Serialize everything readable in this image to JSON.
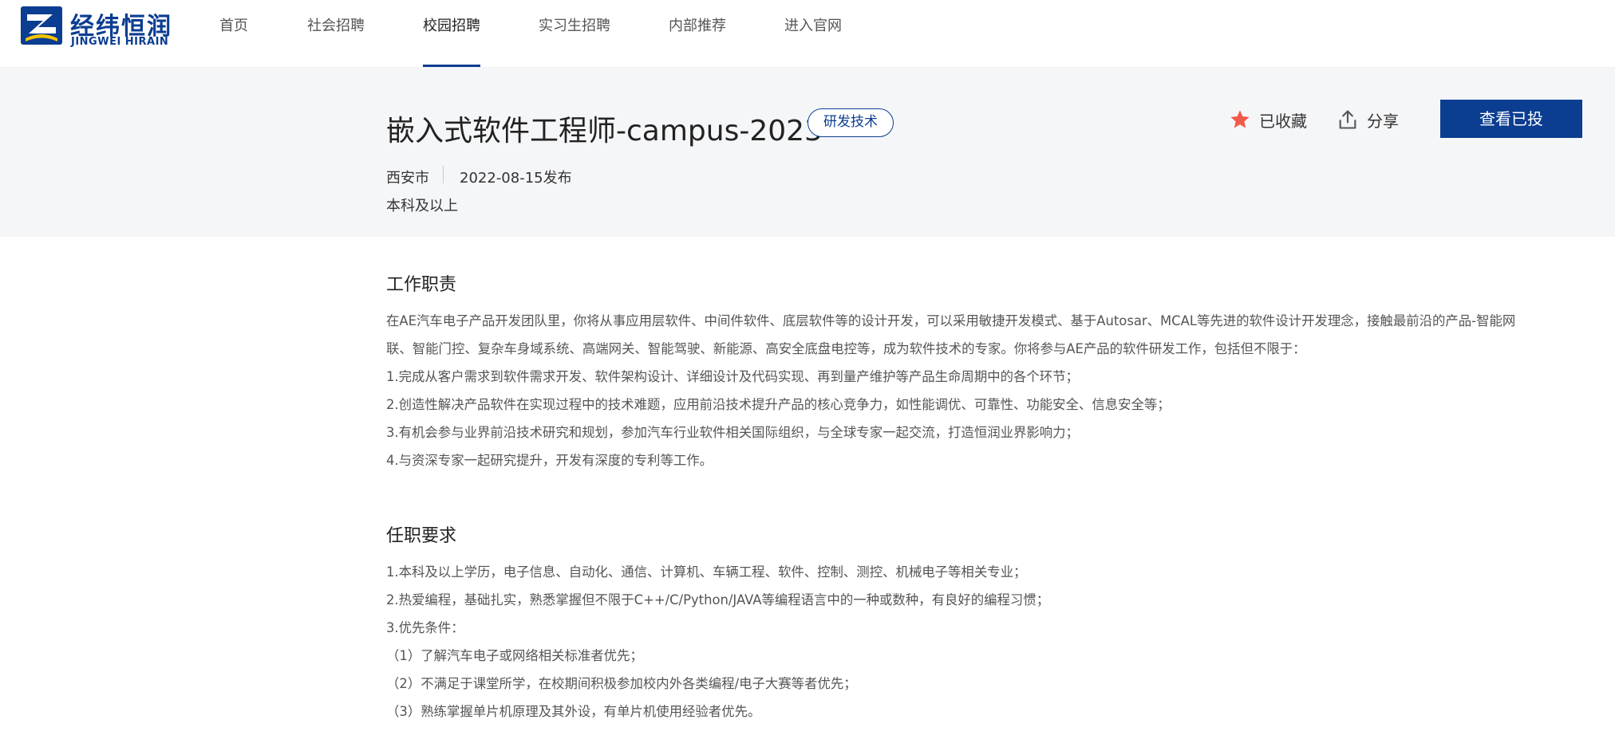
{
  "brand": {
    "name_cn": "经纬恒润",
    "name_en": "JINGWEI HIRAIN",
    "color": "#0b3d91",
    "accent_yellow": "#f5c400"
  },
  "nav": {
    "items": [
      {
        "label": "首页",
        "active": false
      },
      {
        "label": "社会招聘",
        "active": false
      },
      {
        "label": "校园招聘",
        "active": true
      },
      {
        "label": "实习生招聘",
        "active": false
      },
      {
        "label": "内部推荐",
        "active": false
      },
      {
        "label": "进入官网",
        "active": false
      }
    ]
  },
  "job": {
    "title": "嵌入式软件工程师-campus-2023",
    "tag": "研发技术",
    "city": "西安市",
    "date": "2022-08-15发布",
    "education": "本科及以上"
  },
  "actions": {
    "favorite_label": "已收藏",
    "favorite_icon": "star-icon",
    "favorite_color": "#f05a4a",
    "share_label": "分享",
    "share_icon": "share-icon",
    "applied_label": "查看已投"
  },
  "duties": {
    "title": "工作职责",
    "lines": [
      "在AE汽车电子产品开发团队里，你将从事应用层软件、中间件软件、底层软件等的设计开发，可以采用敏捷开发模式、基于Autosar、MCAL等先进的软件设计开发理念，接触最前沿的产品-智能网",
      "联、智能门控、复杂车身域系统、高端网关、智能驾驶、新能源、高安全底盘电控等，成为软件技术的专家。你将参与AE产品的软件研发工作，包括但不限于：",
      "1.完成从客户需求到软件需求开发、软件架构设计、详细设计及代码实现、再到量产维护等产品生命周期中的各个环节；",
      "2.创造性解决产品软件在实现过程中的技术难题，应用前沿技术提升产品的核心竞争力，如性能调优、可靠性、功能安全、信息安全等；",
      "3.有机会参与业界前沿技术研究和规划，参加汽车行业软件相关国际组织，与全球专家一起交流，打造恒润业界影响力；",
      "4.与资深专家一起研究提升，开发有深度的专利等工作。"
    ]
  },
  "requirements": {
    "title": "任职要求",
    "lines": [
      "1.本科及以上学历，电子信息、自动化、通信、计算机、车辆工程、软件、控制、测控、机械电子等相关专业；",
      "2.热爱编程，基础扎实，熟悉掌握但不限于C++/C/Python/JAVA等编程语言中的一种或数种，有良好的编程习惯；",
      "3.优先条件：",
      "（1）了解汽车电子或网络相关标准者优先；",
      "（2）不满足于课堂所学，在校期间积极参加校内外各类编程/电子大赛等者优先；",
      "（3）熟练掌握单片机原理及其外设，有单片机使用经验者优先。"
    ]
  }
}
